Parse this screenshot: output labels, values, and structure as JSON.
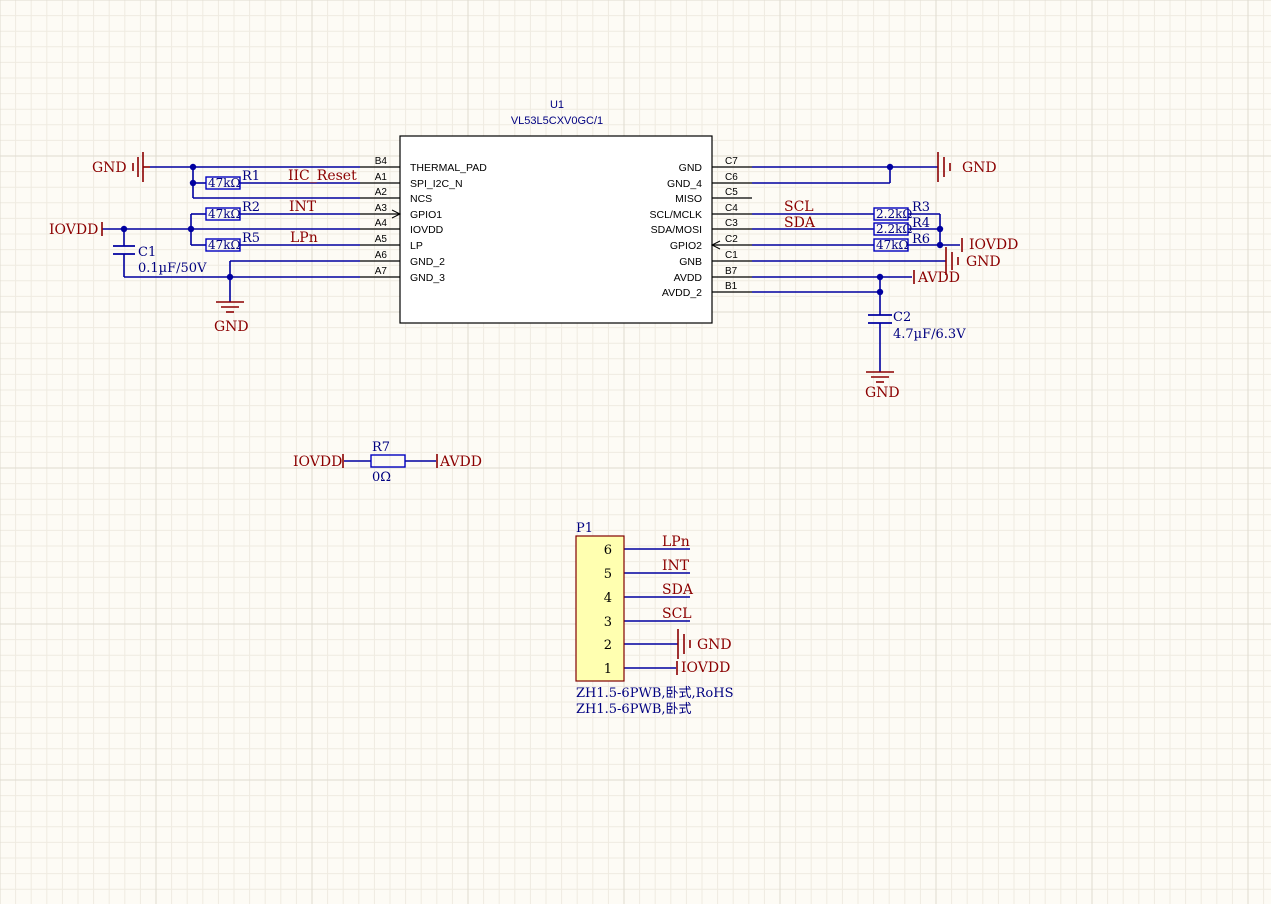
{
  "colors": {
    "background": "#fdfbf5",
    "grid_minor": "#efebe1",
    "grid_major": "#dfdbd0",
    "wire": "#0000a0",
    "net_label": "#8b0000",
    "component_text": "#000080",
    "body_outline": "#800000",
    "connector_fill": "#ffffb0",
    "resistor_outline": "#0000c0"
  },
  "u1": {
    "designator": "U1",
    "part": "VL53L5CXV0GC/1",
    "left_pins": [
      {
        "num": "B4",
        "name": "THERMAL_PAD"
      },
      {
        "num": "A1",
        "name": "SPI_I2C_N"
      },
      {
        "num": "A2",
        "name": "NCS"
      },
      {
        "num": "A3",
        "name": "GPIO1"
      },
      {
        "num": "A4",
        "name": "IOVDD"
      },
      {
        "num": "A5",
        "name": "LP"
      },
      {
        "num": "A6",
        "name": "GND_2"
      },
      {
        "num": "A7",
        "name": "GND_3"
      }
    ],
    "right_pins": [
      {
        "num": "C7",
        "name": "GND"
      },
      {
        "num": "C6",
        "name": "GND_4"
      },
      {
        "num": "C5",
        "name": "MISO"
      },
      {
        "num": "C4",
        "name": "SCL/MCLK"
      },
      {
        "num": "C3",
        "name": "SDA/MOSI"
      },
      {
        "num": "C2",
        "name": "GPIO2"
      },
      {
        "num": "C1",
        "name": "GNB"
      },
      {
        "num": "B7",
        "name": "AVDD"
      },
      {
        "num": "B1",
        "name": "AVDD_2"
      }
    ]
  },
  "resistors": {
    "r1": {
      "ref": "R1",
      "value": "47kΩ"
    },
    "r2": {
      "ref": "R2",
      "value": "47kΩ"
    },
    "r5": {
      "ref": "R5",
      "value": "47kΩ"
    },
    "r3": {
      "ref": "R3",
      "value": "2.2kΩ"
    },
    "r4": {
      "ref": "R4",
      "value": "2.2kΩ"
    },
    "r6": {
      "ref": "R6",
      "value": "47kΩ"
    },
    "r7": {
      "ref": "R7",
      "value": "0Ω"
    }
  },
  "capacitors": {
    "c1": {
      "ref": "C1",
      "value": "0.1µF/50V"
    },
    "c2": {
      "ref": "C2",
      "value": "4.7µF/6.3V"
    }
  },
  "nets": {
    "gnd": "GND",
    "iovdd": "IOVDD",
    "avdd": "AVDD",
    "iic_reset": "IIC_Reset",
    "int": "INT",
    "lpn": "LPn",
    "scl": "SCL",
    "sda": "SDA"
  },
  "p1": {
    "designator": "P1",
    "pins": [
      {
        "num": "6",
        "net": "LPn"
      },
      {
        "num": "5",
        "net": "INT"
      },
      {
        "num": "4",
        "net": "SDA"
      },
      {
        "num": "3",
        "net": "SCL"
      },
      {
        "num": "2",
        "net": "GND"
      },
      {
        "num": "1",
        "net": "IOVDD"
      }
    ],
    "footprint1": "ZH1.5-6PWB,卧式,RoHS",
    "footprint2": "ZH1.5-6PWB,卧式"
  }
}
